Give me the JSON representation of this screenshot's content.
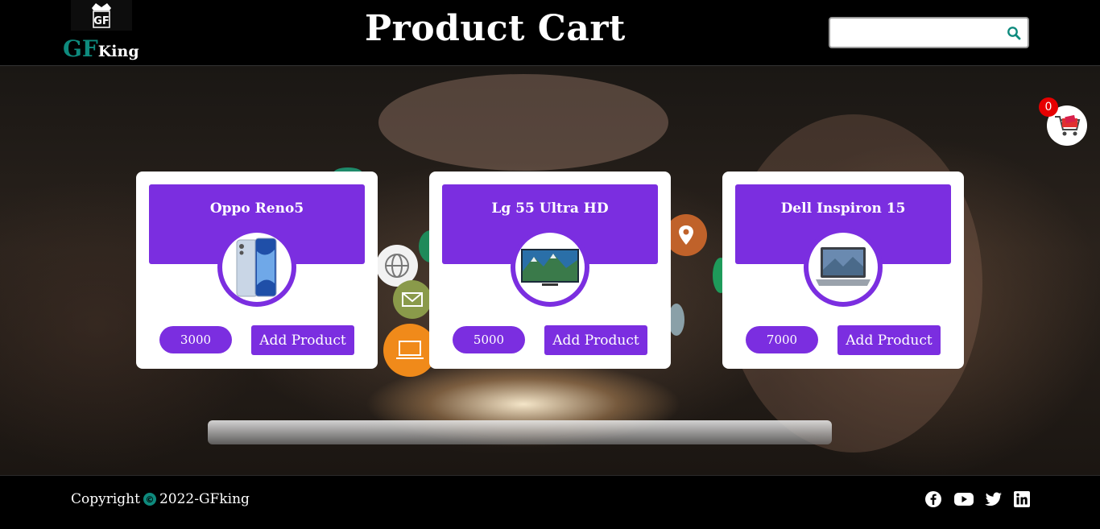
{
  "header": {
    "logo_badge_text": "GF",
    "logo_gf": "GF",
    "logo_king": "King",
    "title": "Product Cart",
    "search_placeholder": "",
    "search_icon": "search-icon"
  },
  "cart": {
    "count": "0",
    "icon": "shopping-cart-icon"
  },
  "products": [
    {
      "name": "Oppo Reno5",
      "price": "3000",
      "button": "Add Product",
      "image": "phone"
    },
    {
      "name": "Lg 55 Ultra HD",
      "price": "5000",
      "button": "Add Product",
      "image": "tv"
    },
    {
      "name": "Dell Inspiron 15",
      "price": "7000",
      "button": "Add Product",
      "image": "laptop"
    }
  ],
  "footer": {
    "copyright_prefix": "Copyright",
    "copyright_suffix": "2022-GFking",
    "social": [
      "facebook-icon",
      "youtube-icon",
      "twitter-icon",
      "linkedin-icon"
    ]
  },
  "colors": {
    "accent": "#7b2ee0",
    "brand_teal": "#0e8a7d",
    "badge_red": "#e60000"
  }
}
